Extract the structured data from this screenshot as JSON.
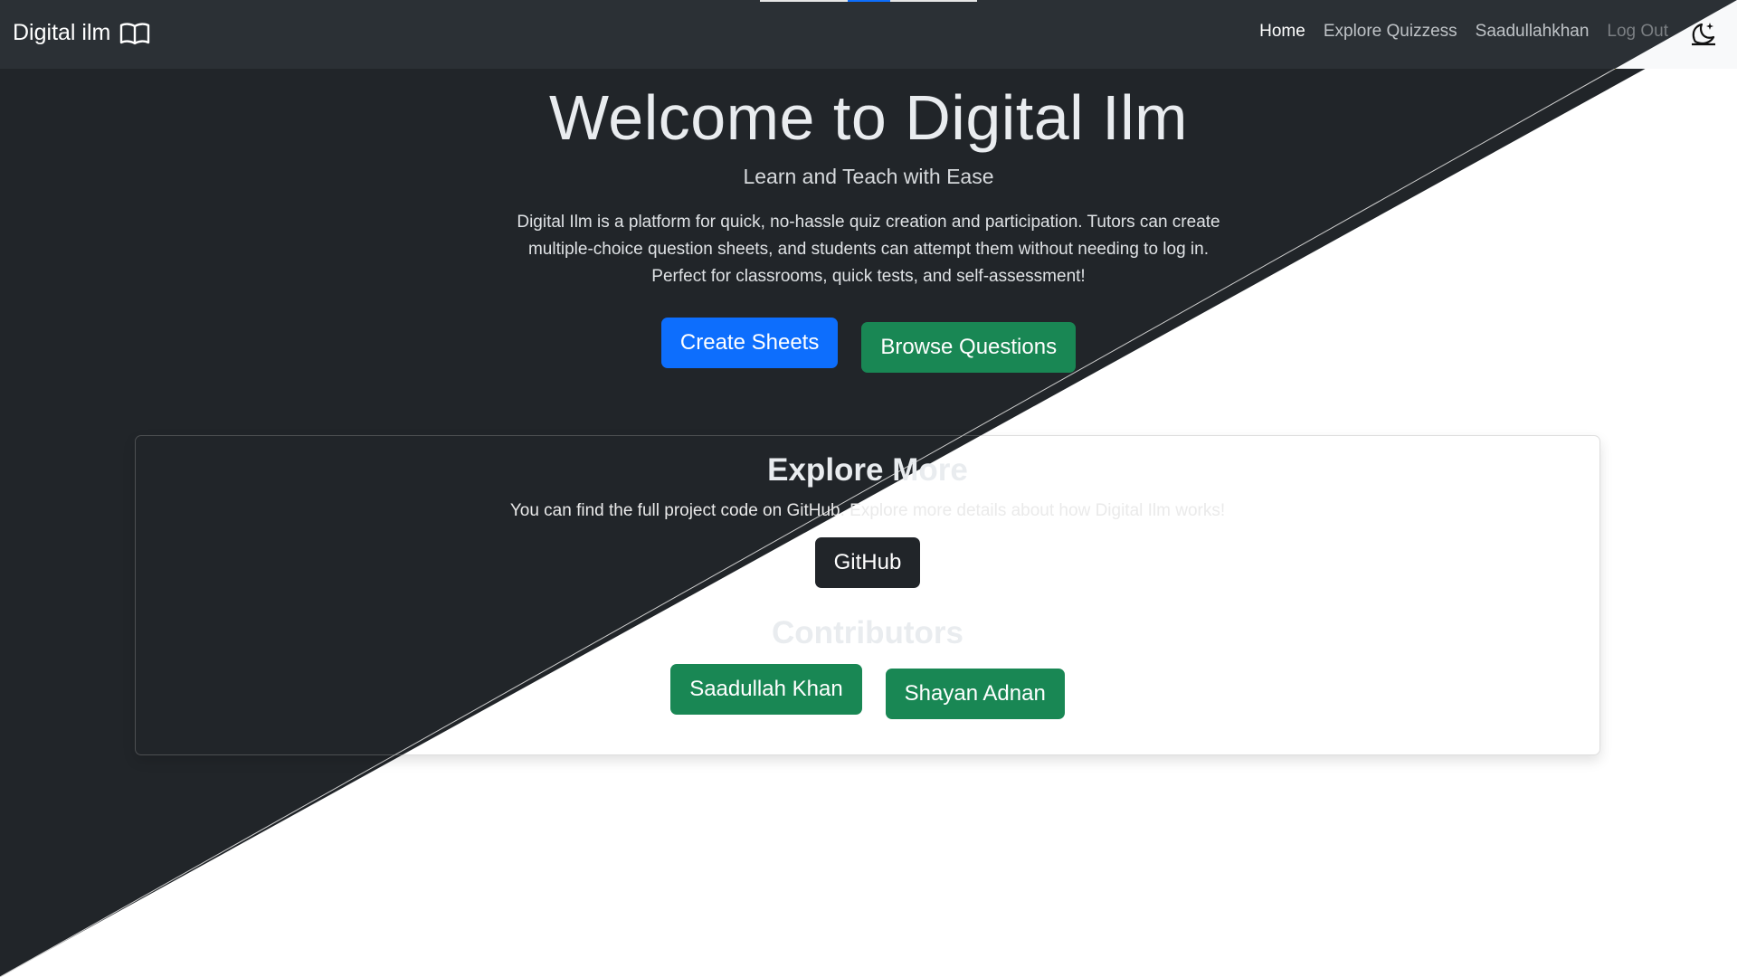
{
  "navbar": {
    "brand": "Digital ilm",
    "brand_icon": "book-open-icon",
    "links": [
      {
        "label": "Home"
      },
      {
        "label": "Explore Quizzess"
      },
      {
        "label": "Saadullahkhan"
      },
      {
        "label": "Log Out"
      }
    ],
    "theme_icon": "moon-stars-icon"
  },
  "hero": {
    "title": "Welcome to Digital Ilm",
    "lead": "Learn and Teach with Ease",
    "description": "Digital Ilm is a platform for quick, no-hassle quiz creation and participation. Tutors can create multiple-choice question sheets, and students can attempt them without needing to log in. Perfect for classrooms, quick tests, and self-assessment!",
    "create_button": "Create Sheets",
    "browse_button": "Browse Questions"
  },
  "explore": {
    "title": "Explore More",
    "subtitle": "You can find the full project code on GitHub. Explore more details about how Digital Ilm works!",
    "github_button": "GitHub",
    "contributors_title": "Contributors",
    "contributors": [
      {
        "name": "Saadullah Khan"
      },
      {
        "name": "Shayan Adnan"
      }
    ]
  },
  "colors": {
    "dark_bg": "#212529",
    "navbar_dark": "#2b3035",
    "primary": "#0d6efd",
    "success": "#198754",
    "accent_line": "#c8b400"
  }
}
